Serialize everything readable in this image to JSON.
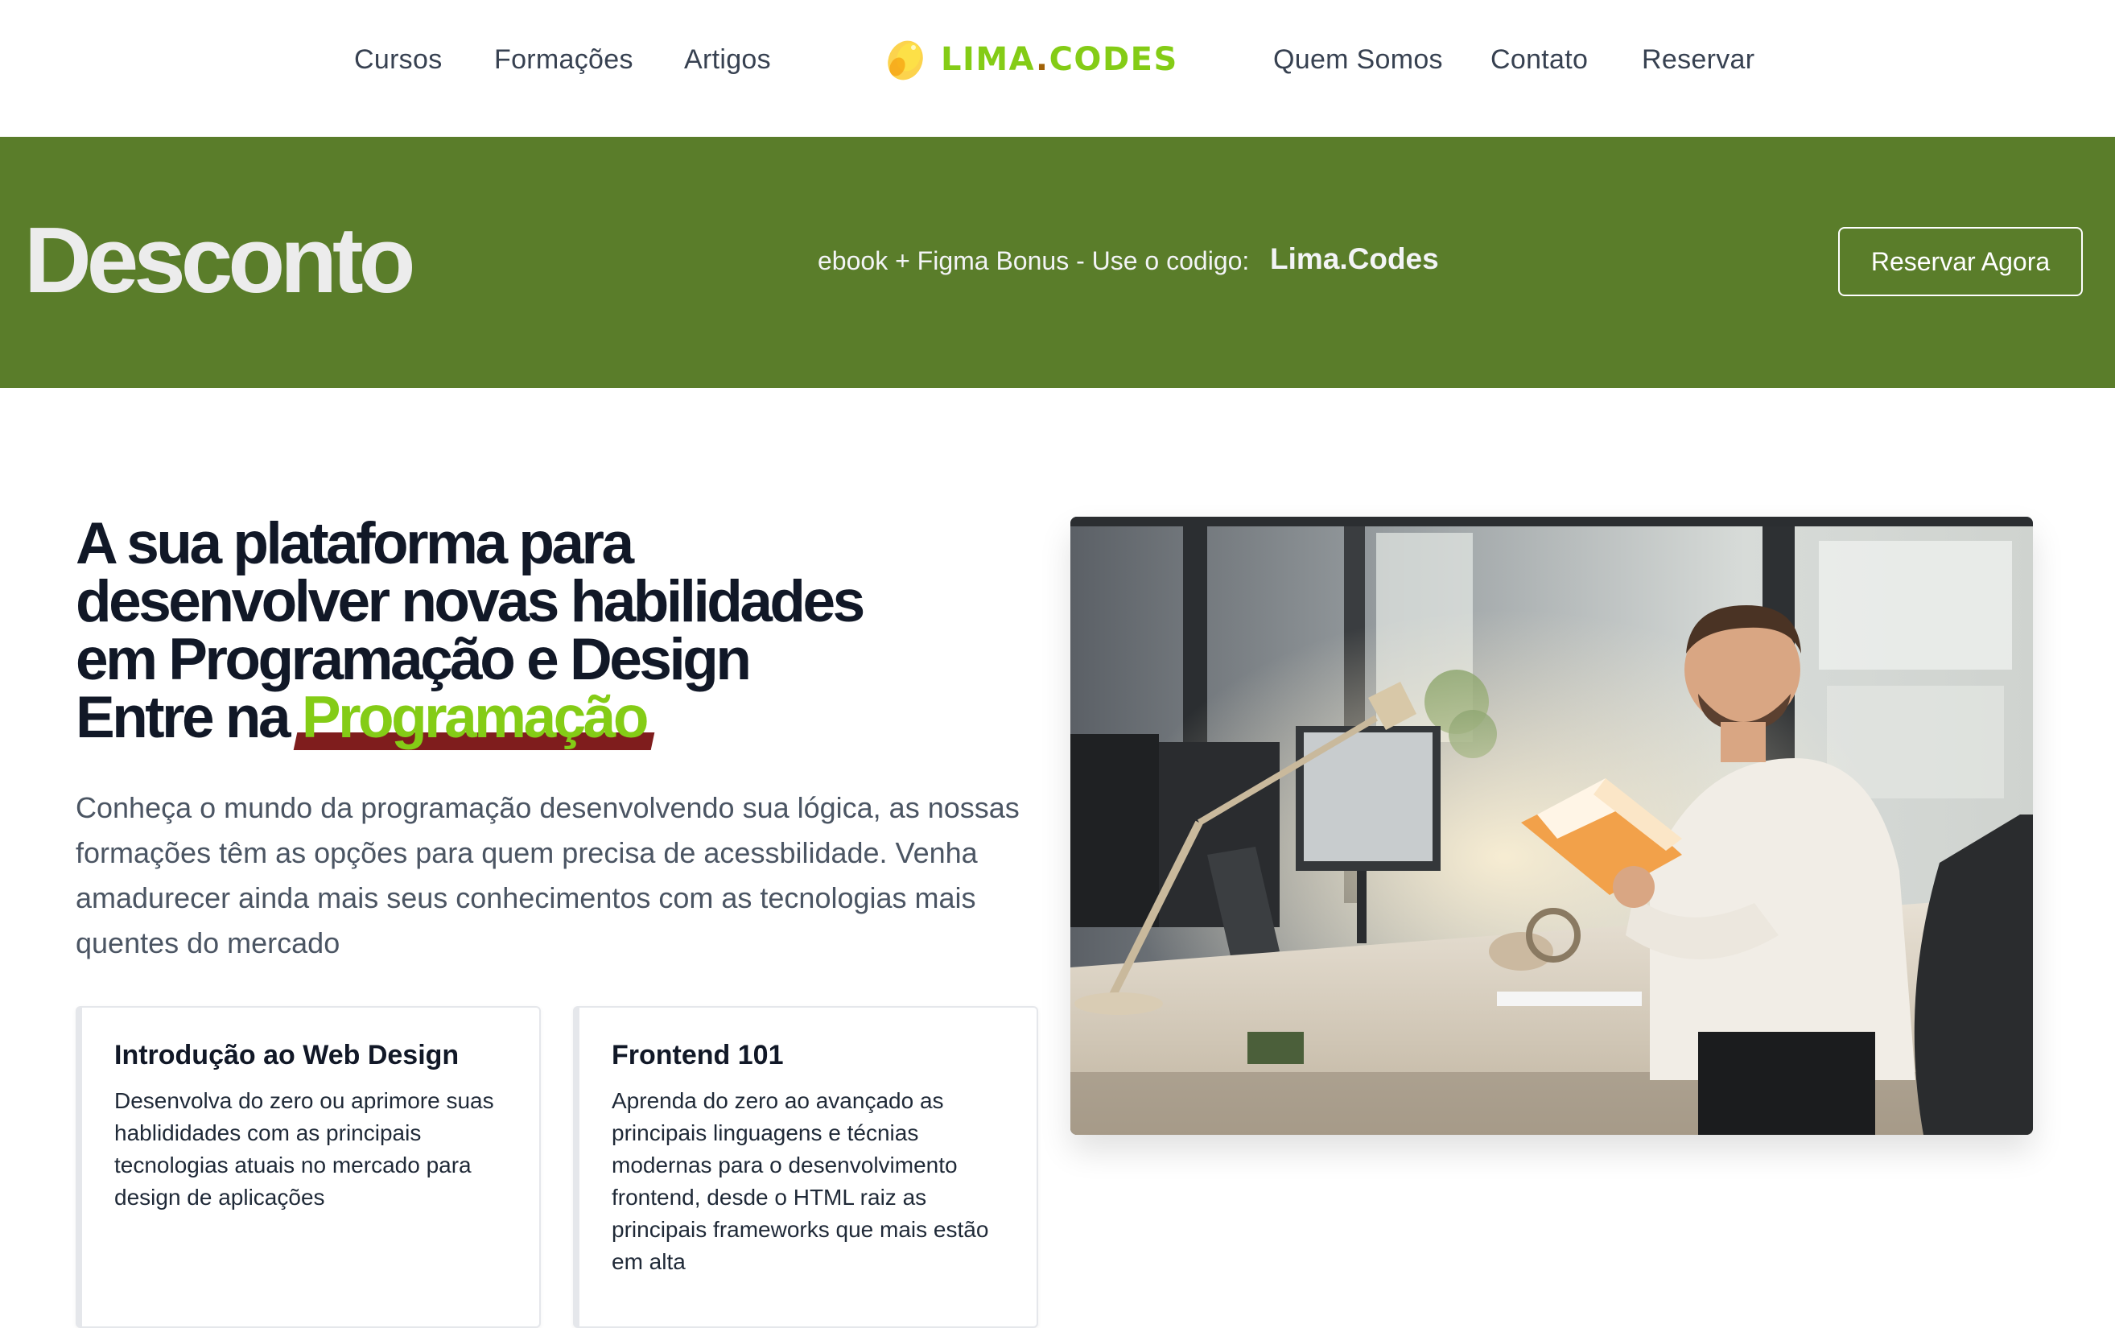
{
  "nav": {
    "left_links": [
      "Cursos",
      "Formações",
      "Artigos"
    ],
    "right_links": [
      "Quem Somos",
      "Contato",
      "Reservar"
    ],
    "logo": {
      "text_main": "LIMA",
      "text_dot": ".",
      "text_end": "CODES",
      "icon": "lemon-icon",
      "color": "#84cc16"
    }
  },
  "banner": {
    "title": "Desconto",
    "text": "ebook + Figma Bonus - Use o codigo:",
    "code": "Lima.Codes",
    "button": "Reservar Agora",
    "background": "#5a7d2a"
  },
  "hero": {
    "title_lines": [
      "A sua plataforma para",
      "desenvolver novas habilidades",
      "em Programação e Design"
    ],
    "title_prefix": "Entre na",
    "title_highlight": "Programação",
    "description": "Conheça o mundo da programação desenvolvendo sua lógica, as nossas formações têm as opções para quem precisa de acessbilidade. Venha amadurecer ainda mais seus conhecimentos com as tecnologias mais quentes do mercado",
    "highlight_color": "#84cc16",
    "underline_color": "#7f1d1d"
  },
  "cards": [
    {
      "title": "Introdução ao Web Design",
      "text": "Desenvolva do zero ou aprimore suas hablididades com as principais tecnologias atuais no mercado para design de aplicações"
    },
    {
      "title": "Frontend 101",
      "text": "Aprenda do zero ao avançado as principais linguagens e técnias modernas para o desenvolvimento frontend, desde o HTML raiz as principais frameworks que mais estão em alta"
    }
  ],
  "photo": {
    "subject": "man-reading-book-at-desk-photo"
  }
}
